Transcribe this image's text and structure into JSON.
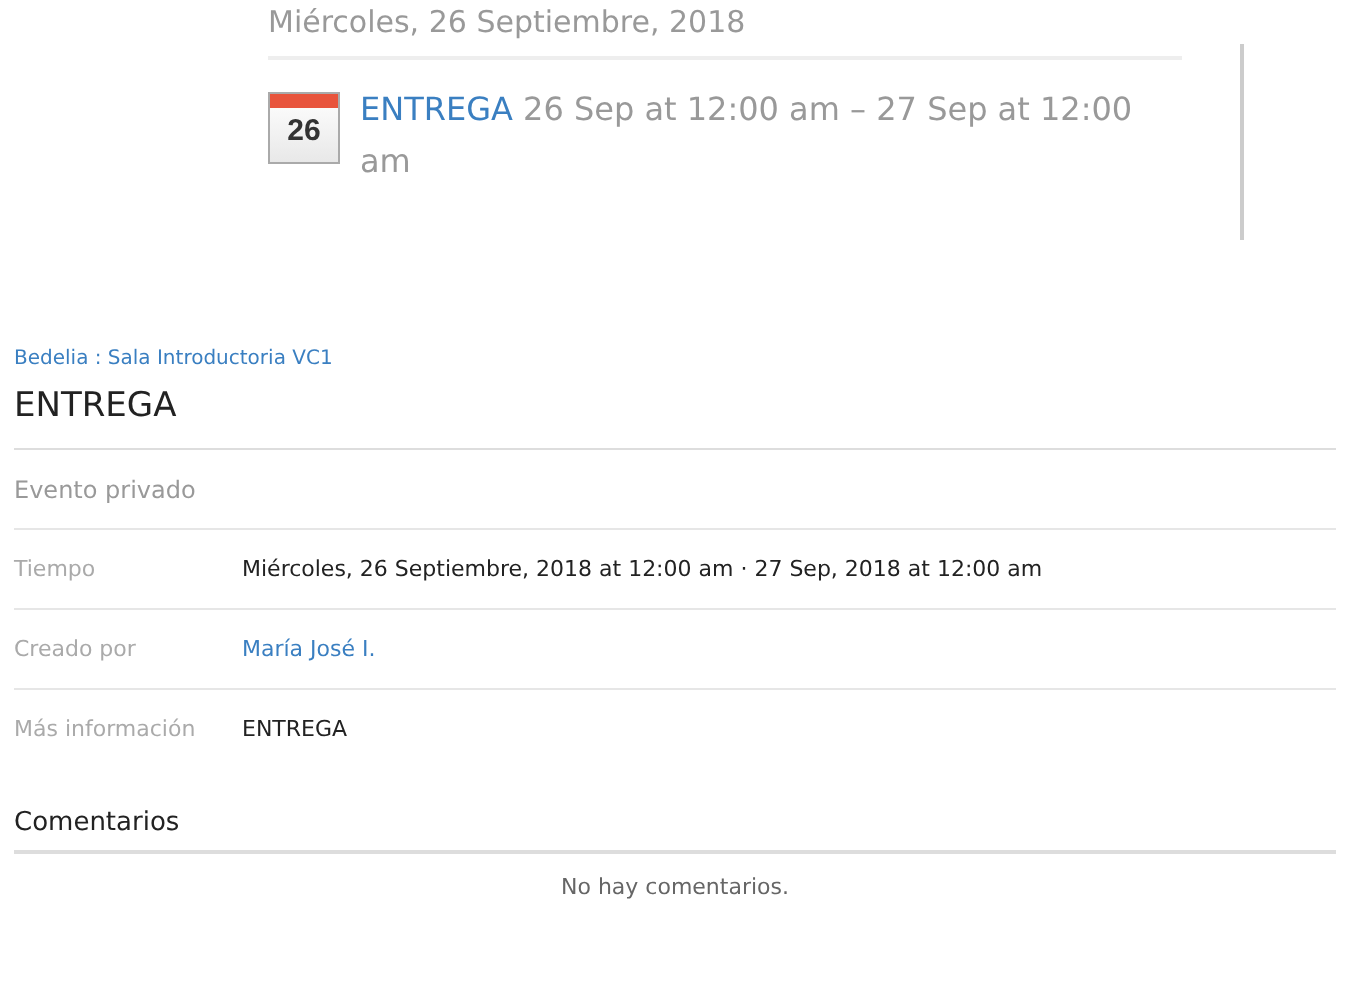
{
  "agenda": {
    "day_heading": "Miércoles, 26 Septiembre, 2018",
    "events": [
      {
        "day": "26",
        "title": "ENTREGA",
        "time": "26 Sep at 12:00 am – 27 Sep at 12:00 am"
      }
    ]
  },
  "event": {
    "calendar": "Bedelia : Sala Introductoria VC1",
    "title": "ENTREGA",
    "privacy": "Evento privado",
    "details": [
      {
        "label": "Tiempo",
        "value": "Miércoles, 26 Septiembre, 2018 at 12:00 am · 27 Sep, 2018 at 12:00 am",
        "kind": "text"
      },
      {
        "label": "Creado por",
        "value": "María José I.",
        "kind": "link"
      },
      {
        "label": "Más información",
        "value": "ENTREGA",
        "kind": "text"
      }
    ]
  },
  "comments": {
    "heading": "Comentarios",
    "empty": "No hay comentarios."
  }
}
